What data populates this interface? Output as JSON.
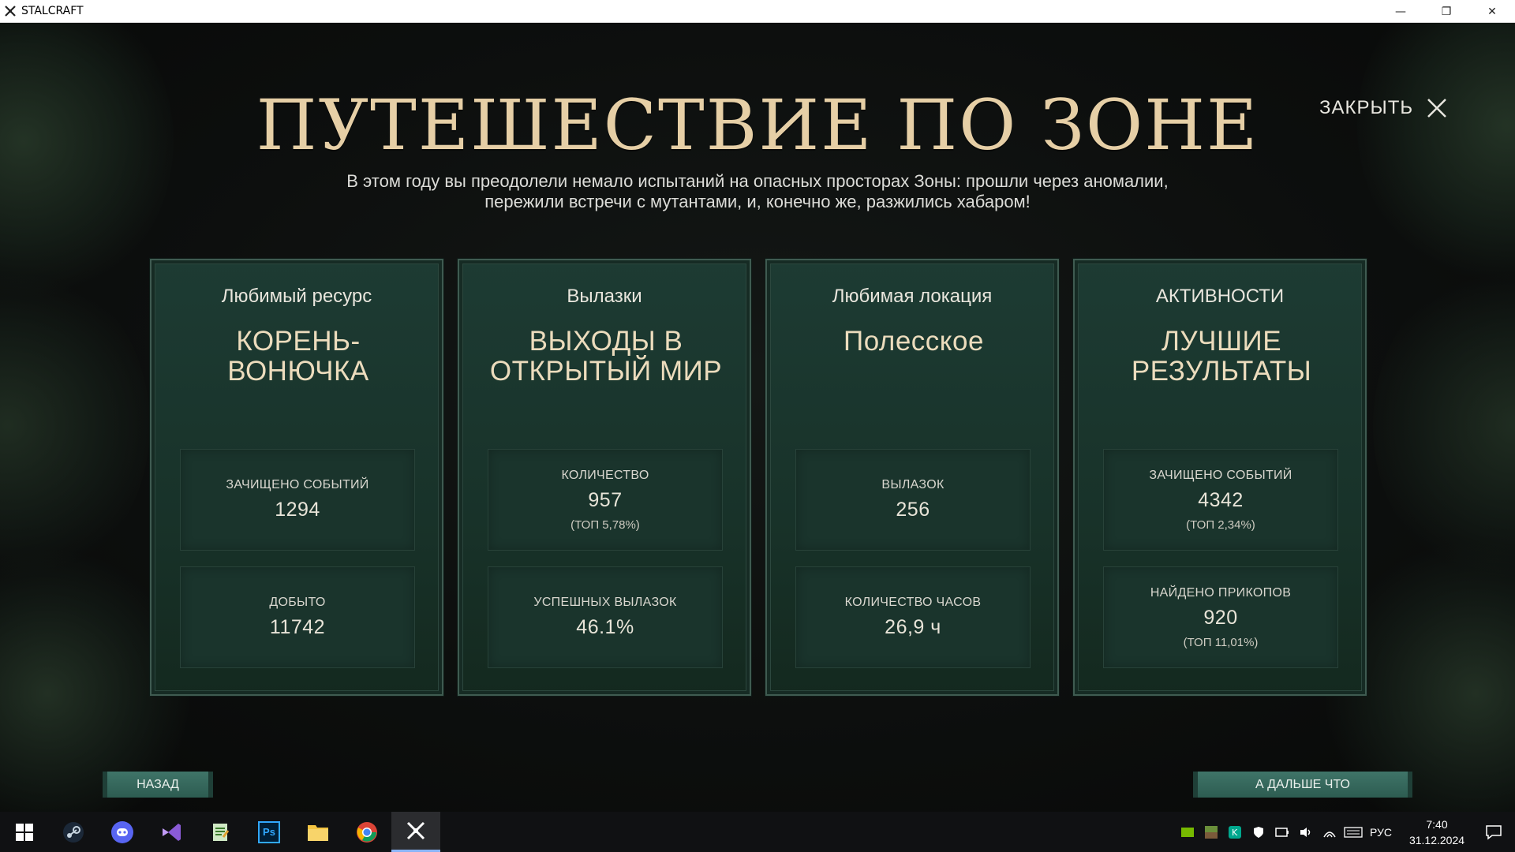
{
  "window": {
    "title": "STALCRAFT",
    "minimize_glyph": "—",
    "restore_glyph": "❐",
    "close_glyph": "✕"
  },
  "header": {
    "title": "ПУТЕШЕСТВИЕ ПО ЗОНЕ",
    "subtitle_line1": "В этом году вы преодолели немало испытаний на опасных просторах Зоны: прошли через аномалии,",
    "subtitle_line2": "пережили встречи с мутантами, и, конечно же, разжились хабаром!",
    "close_label": "ЗАКРЫТЬ"
  },
  "cards": [
    {
      "label": "Любимый ресурс",
      "headline": "КОРЕНЬ-ВОНЮЧКА",
      "stats": [
        {
          "title": "ЗАЧИЩЕНО СОБЫТИЙ",
          "value": "1294",
          "rank": ""
        },
        {
          "title": "ДОБЫТО",
          "value": "11742",
          "rank": ""
        }
      ]
    },
    {
      "label": "Вылазки",
      "headline": "ВЫХОДЫ В ОТКРЫТЫЙ МИР",
      "stats": [
        {
          "title": "КОЛИЧЕСТВО",
          "value": "957",
          "rank": "(ТОП 5,78%)"
        },
        {
          "title": "УСПЕШНЫХ ВЫЛАЗОК",
          "value": "46.1%",
          "rank": ""
        }
      ]
    },
    {
      "label": "Любимая локация",
      "headline": "Полесское",
      "stats": [
        {
          "title": "ВЫЛАЗОК",
          "value": "256",
          "rank": ""
        },
        {
          "title": "КОЛИЧЕСТВО ЧАСОВ",
          "value": "26,9 ч",
          "rank": ""
        }
      ]
    },
    {
      "label": "АКТИВНОСТИ",
      "headline": "ЛУЧШИЕ РЕЗУЛЬТАТЫ",
      "stats": [
        {
          "title": "ЗАЧИЩЕНО СОБЫТИЙ",
          "value": "4342",
          "rank": "(ТОП 2,34%)"
        },
        {
          "title": "НАЙДЕНО ПРИКОПОВ",
          "value": "920",
          "rank": "(ТОП 11,01%)"
        }
      ]
    }
  ],
  "footer": {
    "back_label": "НАЗАД",
    "next_label": "А ДАЛЬШЕ ЧТО"
  },
  "taskbar": {
    "apps": [
      "windows-start-icon",
      "steam-icon",
      "discord-icon",
      "visual-studio-icon",
      "notepad-icon",
      "photoshop-icon",
      "file-explorer-icon",
      "chrome-icon",
      "stalcraft-icon"
    ],
    "active_app": "stalcraft-icon",
    "photoshop_text": "Ps",
    "language": "РУС",
    "time": "7:40",
    "date": "31.12.2024"
  },
  "colors": {
    "title_gold": "#e6cfa6",
    "card_bg": "#1d3b33",
    "button_teal": "#3f7468"
  }
}
